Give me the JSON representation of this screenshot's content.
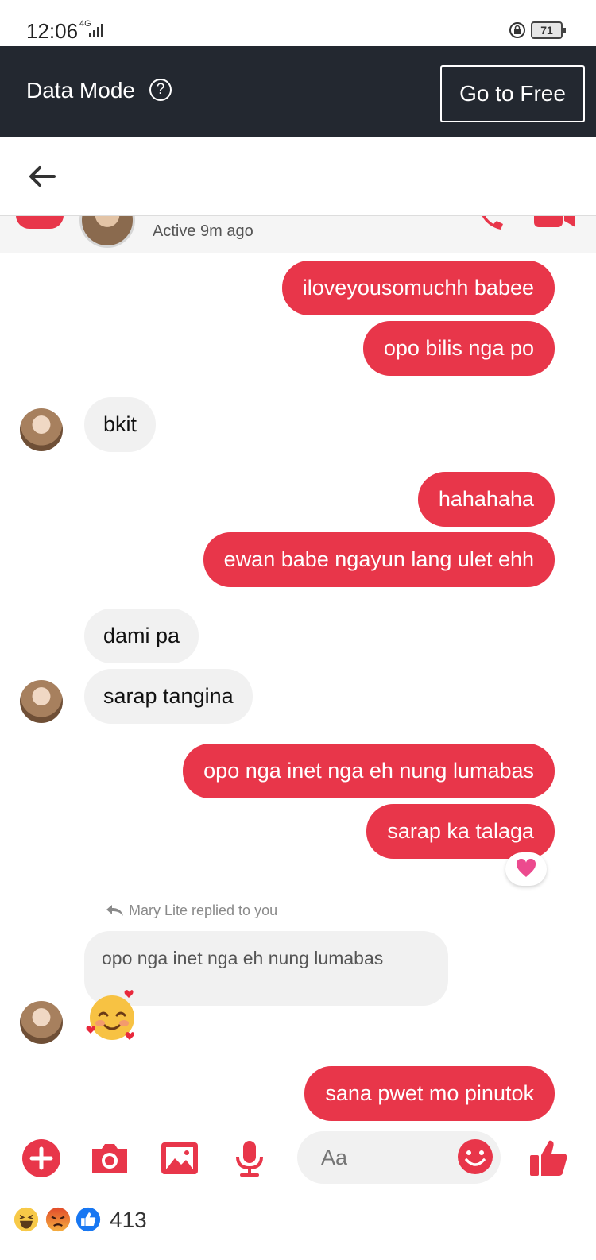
{
  "status": {
    "time": "12:06",
    "network": "4G",
    "battery": "71"
  },
  "data_bar": {
    "label": "Data Mode",
    "help": "?",
    "go_free": "Go to Free"
  },
  "chat_header": {
    "active": "Active 9m ago"
  },
  "messages": [
    {
      "from": "me",
      "text": "iloveyousomuchh babee"
    },
    {
      "from": "me",
      "text": "opo bilis nga po"
    },
    {
      "from": "them",
      "text": "bkit"
    },
    {
      "from": "me",
      "text": "hahahaha"
    },
    {
      "from": "me",
      "text": "ewan babe ngayun lang ulet ehh"
    },
    {
      "from": "them",
      "text": "dami pa"
    },
    {
      "from": "them",
      "text": "sarap tangina"
    },
    {
      "from": "me",
      "text": "opo nga inet nga eh nung lumabas"
    },
    {
      "from": "me",
      "text": "sarap ka talaga",
      "reaction": "heart"
    }
  ],
  "reply": {
    "label": "Mary Lite replied to you",
    "quoted": "opo nga inet nga eh nung lumabas",
    "emoji": "smiling-face-with-hearts"
  },
  "last_message": {
    "from": "me",
    "text": "sana pwet mo pinutok"
  },
  "composer": {
    "placeholder": "Aa"
  },
  "post_reactions": {
    "icons": [
      "haha",
      "angry",
      "like"
    ],
    "count": "413"
  },
  "colors": {
    "accent": "#e8364a",
    "dark_bar": "#232830",
    "incoming_bubble": "#f1f1f1"
  }
}
